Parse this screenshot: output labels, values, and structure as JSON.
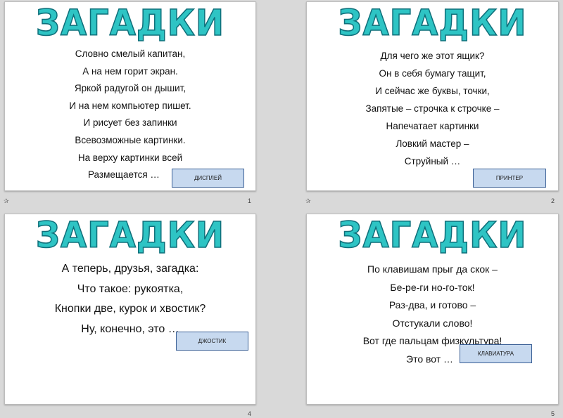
{
  "slides": [
    {
      "title": "ЗАГАДКИ",
      "lines": [
        "Словно смелый капитан,",
        "А на нем горит экран.",
        "Яркой радугой он дышит,",
        "И на нем компьютер пишет.",
        "И рисует без запинки",
        "Всевозможные картинки.",
        "На верху картинки всей",
        "Размещается …"
      ],
      "answer": "ДИСПЛЕЙ",
      "number": "1"
    },
    {
      "title": "ЗАГАДКИ",
      "lines": [
        "Для чего же этот ящик?",
        "Он в себя бумагу тащит,",
        "И сейчас же буквы, точки,",
        "Запятые – строчка к строчке –",
        "Напечатает картинки",
        "Ловкий мастер –",
        "Струйный …"
      ],
      "answer": "ПРИНТЕР",
      "number": "2"
    },
    {
      "title": "ЗАГАДКИ",
      "lines": [
        "А теперь, друзья, загадка:",
        "Что такое: рукоятка,",
        "Кнопки две, курок и хвостик?",
        "Ну, конечно, это …"
      ],
      "answer": "ДЖОСТИК",
      "number": "4"
    },
    {
      "title": "ЗАГАДКИ",
      "lines": [
        "По клавишам прыг да скок –",
        "Бе-ре-ги но-го-ток!",
        "Раз-два, и готово –",
        "Отстукали слово!",
        "Вот где пальцам физкультура!",
        "Это вот …"
      ],
      "answer": "КЛАВИАТУРА",
      "number": "5"
    }
  ],
  "star_glyph": "✰"
}
